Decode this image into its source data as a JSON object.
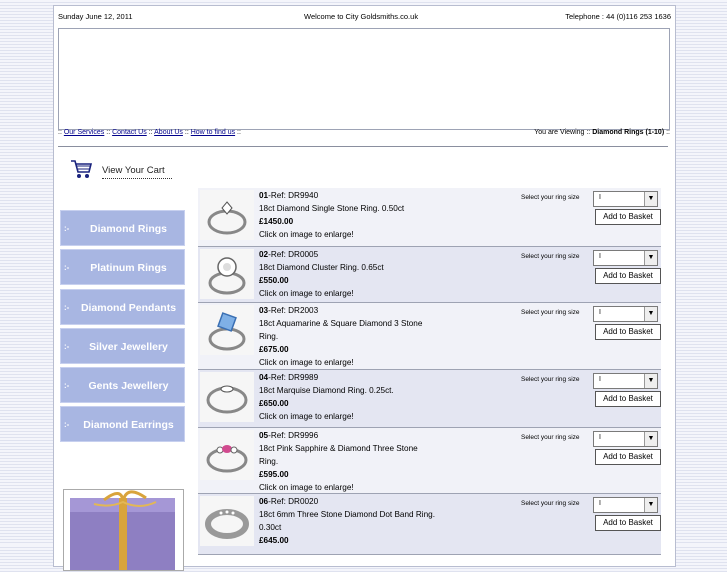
{
  "header": {
    "date": "Sunday June 12, 2011",
    "welcome": "Welcome to City Goldsmiths.co.uk",
    "telephone": "Telephone : 44 (0)116 253 1636"
  },
  "nav": {
    "links": [
      "Our Services",
      "Contact Us",
      "About Us",
      "How to find us"
    ],
    "separator": "::",
    "viewing_prefix": "You are Viewing ::",
    "viewing_value": "Diamond Rings (1-10)"
  },
  "cart": {
    "label": "View Your Cart"
  },
  "categories": [
    "Diamond Rings",
    "Platinum Rings",
    "Diamond Pendants",
    "Silver Jewellery",
    "Gents Jewellery",
    "Diamond Earrings"
  ],
  "category_bullet": ":-",
  "products": [
    {
      "num": "01",
      "ref": "-Ref: DR9940",
      "name": "18ct Diamond Single Stone Ring. 0.50ct",
      "price": "£1450.00",
      "enlarge": "Click on image to enlarge!",
      "size": "I"
    },
    {
      "num": "02",
      "ref": "-Ref: DR0005",
      "name": "18ct Diamond Cluster Ring. 0.65ct",
      "price": "£550.00",
      "enlarge": "Click on image to enlarge!",
      "size": "I"
    },
    {
      "num": "03",
      "ref": "-Ref: DR2003",
      "name": "18ct Aquamarine & Square Diamond 3 Stone Ring.",
      "price": "£675.00",
      "enlarge": "Click on image to enlarge!",
      "size": "I"
    },
    {
      "num": "04",
      "ref": "-Ref: DR9989",
      "name": "18ct Marquise Diamond Ring. 0.25ct.",
      "price": "£650.00",
      "enlarge": "Click on image to enlarge!",
      "size": "I"
    },
    {
      "num": "05",
      "ref": "-Ref: DR9996",
      "name": "18ct Pink Sapphire & Diamond Three Stone Ring.",
      "price": "£595.00",
      "enlarge": "Click on image to enlarge!",
      "size": "I"
    },
    {
      "num": "06",
      "ref": "-Ref: DR0020",
      "name": "18ct 6mm Three Stone Diamond Dot Band Ring. 0.30ct",
      "price": "£645.00",
      "enlarge": "",
      "size": "I"
    }
  ],
  "ring_size_label": "Select your ring size",
  "add_button": "Add to Basket",
  "colors": {
    "category_bg": "#a8b6e2",
    "link": "#00008b",
    "row_bg": "#f1f2f8",
    "row_alt_bg": "#e4e6f2"
  }
}
